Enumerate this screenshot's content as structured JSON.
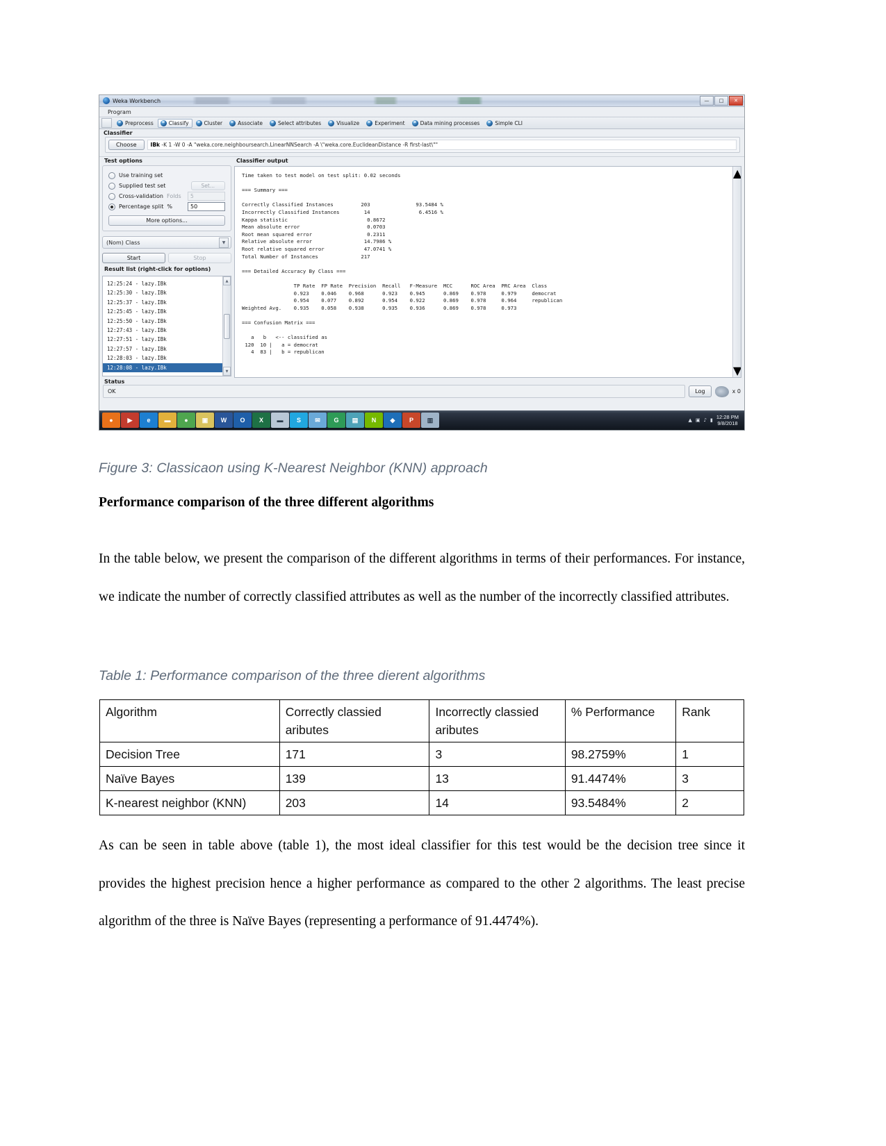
{
  "weka": {
    "window_title": "Weka Workbench",
    "window_buttons": {
      "minimize": "—",
      "maximize": "□",
      "close": "✕"
    },
    "menu": {
      "program": "Program"
    },
    "tabs": [
      {
        "label": "Preprocess",
        "icon": "weka-bird-icon",
        "active": false
      },
      {
        "label": "Classify",
        "icon": "weka-bird-icon",
        "active": true
      },
      {
        "label": "Cluster",
        "icon": "weka-bird-icon",
        "active": false
      },
      {
        "label": "Associate",
        "icon": "weka-bird-icon",
        "active": false
      },
      {
        "label": "Select attributes",
        "icon": "weka-bird-icon",
        "active": false
      },
      {
        "label": "Visualize",
        "icon": "weka-bird-icon",
        "active": false
      },
      {
        "label": "Experiment",
        "icon": "weka-bird-icon",
        "active": false
      },
      {
        "label": "Data mining processes",
        "icon": "weka-bird-icon",
        "active": false
      },
      {
        "label": "Simple CLI",
        "icon": "weka-bird-icon",
        "active": false
      }
    ],
    "classifier": {
      "group_label": "Classifier",
      "choose_label": "Choose",
      "scheme_name": "IBk",
      "scheme_options": " -K 1 -W 0 -A \"weka.core.neighboursearch.LinearNNSearch -A \\\"weka.core.EuclideanDistance -R first-last\\\"\""
    },
    "test_options": {
      "group_label": "Test options",
      "items": [
        {
          "label": "Use training set",
          "selected": false
        },
        {
          "label": "Supplied test set",
          "selected": false,
          "button": "Set..."
        },
        {
          "label": "Cross-validation",
          "selected": false,
          "sub_label": "Folds",
          "sub_value": "5"
        },
        {
          "label": "Percentage split",
          "selected": true,
          "sub_label": "%",
          "sub_value": "50"
        }
      ],
      "more_options": "More options...",
      "class_combo": "(Nom) Class",
      "start_button": "Start",
      "stop_button": "Stop"
    },
    "result_list": {
      "caption": "Result list (right-click for options)",
      "items": [
        {
          "label": "12:25:24 - lazy.IBk",
          "selected": false
        },
        {
          "label": "12:25:30 - lazy.IBk",
          "selected": false
        },
        {
          "label": "12:25:37 - lazy.IBk",
          "selected": false
        },
        {
          "label": "12:25:45 - lazy.IBk",
          "selected": false
        },
        {
          "label": "12:25:50 - lazy.IBk",
          "selected": false
        },
        {
          "label": "12:27:43 - lazy.IBk",
          "selected": false
        },
        {
          "label": "12:27:51 - lazy.IBk",
          "selected": false
        },
        {
          "label": "12:27:57 - lazy.IBk",
          "selected": false
        },
        {
          "label": "12:28:03 - lazy.IBk",
          "selected": false
        },
        {
          "label": "12:28:08 - lazy.IBk",
          "selected": true
        }
      ]
    },
    "classifier_output": {
      "caption": "Classifier output",
      "text": "Time taken to test model on test split: 0.02 seconds\n\n=== Summary ===\n\nCorrectly Classified Instances         203               93.5484 %\nIncorrectly Classified Instances        14                6.4516 %\nKappa statistic                          0.8672\nMean absolute error                      0.0703\nRoot mean squared error                  0.2311\nRelative absolute error                 14.7986 %\nRoot relative squared error             47.0741 %\nTotal Number of Instances              217\n\n=== Detailed Accuracy By Class ===\n\n                 TP Rate  FP Rate  Precision  Recall   F-Measure  MCC      ROC Area  PRC Area  Class\n                 0.923    0.046    0.968      0.923    0.945      0.869    0.978     0.979     democrat\n                 0.954    0.077    0.892      0.954    0.922      0.869    0.978     0.964     republican\nWeighted Avg.    0.935    0.058    0.938      0.935    0.936      0.869    0.978     0.973\n\n=== Confusion Matrix ===\n\n   a   b   <-- classified as\n 120  10 |   a = democrat\n   4  83 |   b = republican"
    },
    "status": {
      "label": "Status",
      "value": "OK",
      "log_button": "Log",
      "bird_count": "x 0"
    },
    "taskbar": {
      "icons": [
        {
          "name": "firefox-icon",
          "glyph": "●",
          "color": "#e8711a"
        },
        {
          "name": "media-player-icon",
          "glyph": "▶",
          "color": "#c33c2e"
        },
        {
          "name": "internet-explorer-icon",
          "glyph": "e",
          "color": "#1d7fd1"
        },
        {
          "name": "folder-icon",
          "glyph": "▬",
          "color": "#e2b13c"
        },
        {
          "name": "chrome-icon",
          "glyph": "●",
          "color": "#4fa64f"
        },
        {
          "name": "camera-icon",
          "glyph": "▣",
          "color": "#d9c35e"
        },
        {
          "name": "word-icon",
          "glyph": "W",
          "color": "#2a5699"
        },
        {
          "name": "outlook-icon",
          "glyph": "O",
          "color": "#1f5fa9"
        },
        {
          "name": "excel-icon",
          "glyph": "X",
          "color": "#1e7145"
        },
        {
          "name": "explorer-icon",
          "glyph": "▬",
          "color": "#b9c7d6"
        },
        {
          "name": "skype-icon",
          "glyph": "S",
          "color": "#21a7e0"
        },
        {
          "name": "mail-icon",
          "glyph": "✉",
          "color": "#6aa9d8"
        },
        {
          "name": "grammarly-icon",
          "glyph": "G",
          "color": "#2e9b57"
        },
        {
          "name": "drive-icon",
          "glyph": "▤",
          "color": "#4ea3b8"
        },
        {
          "name": "nvidia-icon",
          "glyph": "N",
          "color": "#76b900"
        },
        {
          "name": "app-icon",
          "glyph": "◆",
          "color": "#1e6fb8"
        },
        {
          "name": "powerpoint-icon",
          "glyph": "P",
          "color": "#c8472a"
        },
        {
          "name": "document-icon",
          "glyph": "▥",
          "color": "#9fb4c8"
        }
      ],
      "tray": [
        "▲",
        "▣",
        "🔊",
        "▮"
      ],
      "clock_time": "12:28 PM",
      "clock_date": "9/8/2018"
    }
  },
  "document": {
    "figure_caption": "Figure 3: Classicaon using K-Nearest Neighbor (KNN) approach",
    "section_heading": "Performance comparison of the three different algorithms",
    "paragraph_1": "In the table below, we present the comparison of the different algorithms in terms of their performances. For instance, we indicate the number of correctly classified attributes as well as the number of the incorrectly classified attributes.",
    "table_caption": "Table 1: Performance comparison of the three dierent algorithms",
    "paragraph_2": "As can be seen in table above (table 1), the most ideal classifier for this test would be the decision tree since it provides the highest precision hence a higher performance as compared to the other 2 algorithms. The least precise algorithm of the three is Naïve Bayes (representing a performance of 91.4474%).",
    "table": {
      "headers": [
        "Algorithm",
        "Correctly classied aributes",
        "Incorrectly classied aributes",
        "% Performance",
        "Rank"
      ],
      "rows": [
        {
          "algorithm": "Decision Tree",
          "correct": "171",
          "incorrect": "3",
          "performance": "98.2759%",
          "rank": "1"
        },
        {
          "algorithm": "Naïve Bayes",
          "correct": "139",
          "incorrect": "13",
          "performance": "91.4474%",
          "rank": "3"
        },
        {
          "algorithm": "K-nearest neighbor (KNN)",
          "correct": "203",
          "incorrect": "14",
          "performance": "93.5484%",
          "rank": "2"
        }
      ]
    }
  }
}
